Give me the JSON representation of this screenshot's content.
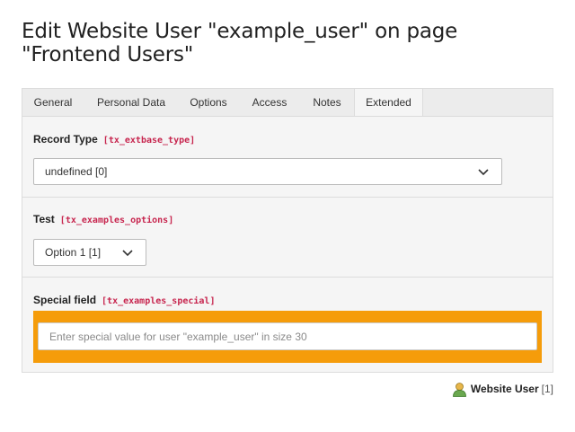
{
  "page": {
    "title": "Edit Website User \"example_user\" on page \"Frontend Users\""
  },
  "tabs": [
    {
      "label": "General"
    },
    {
      "label": "Personal Data"
    },
    {
      "label": "Options"
    },
    {
      "label": "Access"
    },
    {
      "label": "Notes"
    },
    {
      "label": "Extended",
      "active": true
    }
  ],
  "fields": {
    "record_type": {
      "label": "Record Type",
      "key": "[tx_extbase_type]",
      "value": "undefined [0]"
    },
    "test": {
      "label": "Test",
      "key": "[tx_examples_options]",
      "value": "Option 1 [1]"
    },
    "special": {
      "label": "Special field",
      "key": "[tx_examples_special]",
      "placeholder": "Enter special value for user \"example_user\" in size 30",
      "value": ""
    }
  },
  "footer": {
    "record_type_label": "Website User",
    "uid": "[1]",
    "icon": "user-icon"
  },
  "colors": {
    "highlight": "#f59c0a",
    "field_key": "#c7254e",
    "tab_bar": "#ececec",
    "panel": "#f5f5f5"
  }
}
